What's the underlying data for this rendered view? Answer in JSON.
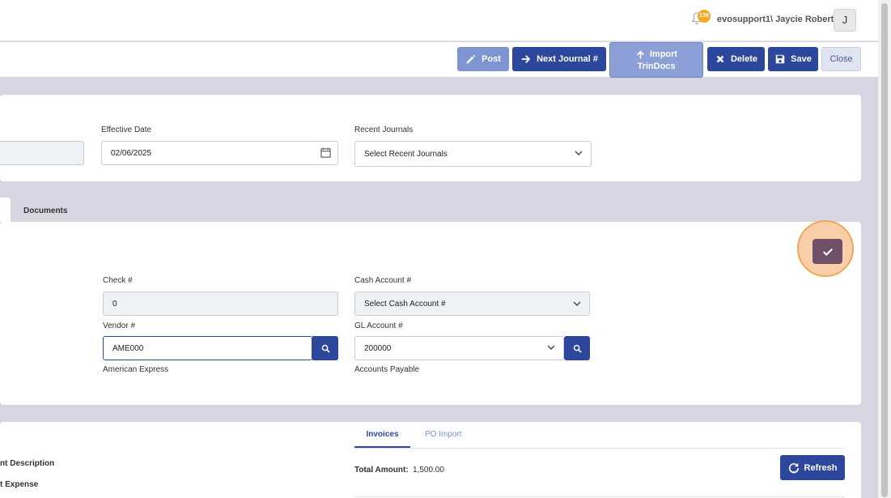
{
  "header": {
    "notification_count": "136",
    "user_label": "evosupport1\\ Jaycie Roberts",
    "avatar_initial": "J"
  },
  "toolbar": {
    "post_label": "Post",
    "next_journal_label": "Next Journal #",
    "import_line1": "Import",
    "import_line2": "TrinDocs",
    "delete_label": "Delete",
    "save_label": "Save",
    "close_label": "Close"
  },
  "journal": {
    "effective_date_label": "Effective Date",
    "effective_date_value": "02/06/2025",
    "recent_journals_label": "Recent Journals",
    "recent_journals_value": "Select Recent Journals"
  },
  "tabs": {
    "documents_label": "Documents"
  },
  "payment": {
    "check_label": "Check #",
    "check_value": "0",
    "cash_account_label": "Cash Account #",
    "cash_account_value": "Select Cash Account #",
    "vendor_label": "Vendor #",
    "vendor_value": "AME000",
    "vendor_name": "American Express",
    "gl_account_label": "GL Account #",
    "gl_account_value": "200000",
    "gl_account_name": "Accounts Payable"
  },
  "lines": {
    "left_label_1": "nt Description",
    "left_label_2": "t Expense",
    "tab_invoices": "Invoices",
    "tab_po_import": "PO Import",
    "total_amount_label": "Total Amount:",
    "total_amount_value": "1,500.00",
    "refresh_label": "Refresh"
  },
  "colors": {
    "primary": "#2c479c",
    "primary_light": "#7e95d2",
    "highlight": "#f2a65a",
    "check_button": "#6e5168"
  }
}
